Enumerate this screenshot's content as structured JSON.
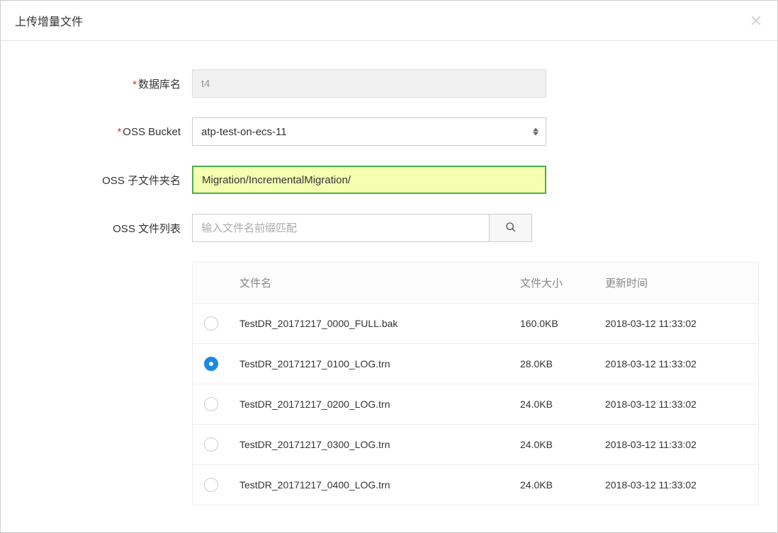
{
  "dialog": {
    "title": "上传增量文件"
  },
  "form": {
    "dbname_label": "数据库名",
    "dbname_value": "t4",
    "ossbucket_label": "OSS Bucket",
    "ossbucket_value": "atp-test-on-ecs-11",
    "subfolder_label": "OSS 子文件夹名",
    "subfolder_value": "Migration/IncrementalMigration/",
    "filelist_label": "OSS 文件列表",
    "search_placeholder": "输入文件名前缀匹配"
  },
  "table": {
    "headers": {
      "name": "文件名",
      "size": "文件大小",
      "time": "更新时间"
    },
    "rows": [
      {
        "selected": false,
        "name": "TestDR_20171217_0000_FULL.bak",
        "size": "160.0KB",
        "time": "2018-03-12 11:33:02"
      },
      {
        "selected": true,
        "name": "TestDR_20171217_0100_LOG.trn",
        "size": "28.0KB",
        "time": "2018-03-12 11:33:02"
      },
      {
        "selected": false,
        "name": "TestDR_20171217_0200_LOG.trn",
        "size": "24.0KB",
        "time": "2018-03-12 11:33:02"
      },
      {
        "selected": false,
        "name": "TestDR_20171217_0300_LOG.trn",
        "size": "24.0KB",
        "time": "2018-03-12 11:33:02"
      },
      {
        "selected": false,
        "name": "TestDR_20171217_0400_LOG.trn",
        "size": "24.0KB",
        "time": "2018-03-12 11:33:02"
      }
    ]
  }
}
